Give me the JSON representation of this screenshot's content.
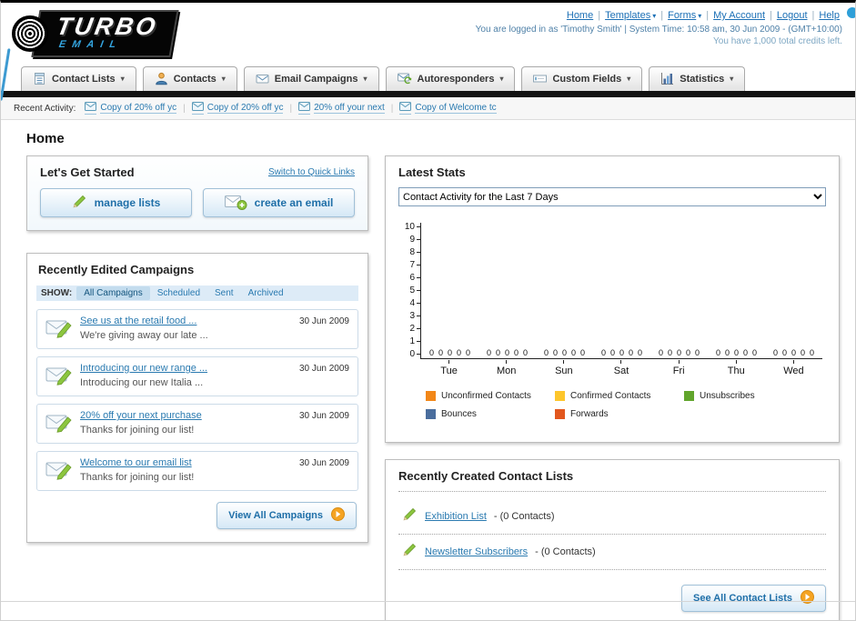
{
  "header": {
    "logo_text": "TURBO",
    "logo_sub": "EMAIL",
    "top_links": [
      {
        "label": "Home",
        "caret": false
      },
      {
        "label": "Templates",
        "caret": true
      },
      {
        "label": "Forms",
        "caret": true
      },
      {
        "label": "My Account",
        "caret": false
      },
      {
        "label": "Logout",
        "caret": false
      },
      {
        "label": "Help",
        "caret": false
      }
    ],
    "login_info": "You are logged in as 'Timothy Smith' | System Time: 10:58 am, 30 Jun 2009 - (GMT+10:00)",
    "credits": "You have 1,000 total credits left."
  },
  "nav": {
    "items": [
      {
        "label": "Contact Lists",
        "icon": "contact-lists-icon"
      },
      {
        "label": "Contacts",
        "icon": "contacts-icon"
      },
      {
        "label": "Email Campaigns",
        "icon": "email-campaigns-icon"
      },
      {
        "label": "Autoresponders",
        "icon": "autoresponders-icon"
      },
      {
        "label": "Custom Fields",
        "icon": "custom-fields-icon"
      },
      {
        "label": "Statistics",
        "icon": "statistics-icon"
      }
    ]
  },
  "recent_activity": {
    "label": "Recent Activity:",
    "items": [
      "Copy of 20% off yc",
      "Copy of 20% off yc",
      "20% off your next",
      "Copy of Welcome tc"
    ]
  },
  "page_title": "Home",
  "get_started": {
    "title": "Let's Get Started",
    "switch_link": "Switch to Quick Links",
    "buttons": [
      {
        "label": "manage lists"
      },
      {
        "label": "create an email"
      }
    ]
  },
  "campaigns": {
    "title": "Recently Edited Campaigns",
    "show_label": "SHOW:",
    "filters": [
      "All Campaigns",
      "Scheduled",
      "Sent",
      "Archived"
    ],
    "active_filter": "All Campaigns",
    "rows": [
      {
        "title": "See us at the retail food ...",
        "subtitle": "We're giving away our late ...",
        "date": "30 Jun 2009"
      },
      {
        "title": "Introducing our new range ...",
        "subtitle": "Introducing our new Italia ...",
        "date": "30 Jun 2009"
      },
      {
        "title": "20% off your next purchase",
        "subtitle": "Thanks for joining our list!",
        "date": "30 Jun 2009"
      },
      {
        "title": "Welcome to our email list",
        "subtitle": "Thanks for joining our list!",
        "date": "30 Jun 2009"
      }
    ],
    "view_all_label": "View All Campaigns"
  },
  "stats": {
    "title": "Latest Stats",
    "dropdown_value": "Contact Activity for the Last 7 Days",
    "legend": [
      {
        "label": "Unconfirmed Contacts",
        "color": "#f28718"
      },
      {
        "label": "Confirmed Contacts",
        "color": "#fdc62c"
      },
      {
        "label": "Unsubscribes",
        "color": "#61a52c"
      },
      {
        "label": "Bounces",
        "color": "#4a6d9d"
      },
      {
        "label": "Forwards",
        "color": "#e2571e"
      }
    ]
  },
  "chart_data": {
    "type": "bar",
    "title": "Contact Activity for the Last 7 Days",
    "categories": [
      "Tue",
      "Mon",
      "Sun",
      "Sat",
      "Fri",
      "Thu",
      "Wed"
    ],
    "series": [
      {
        "name": "Unconfirmed Contacts",
        "color": "#f28718",
        "values": [
          0,
          0,
          0,
          0,
          0,
          0,
          0
        ]
      },
      {
        "name": "Confirmed Contacts",
        "color": "#fdc62c",
        "values": [
          0,
          0,
          0,
          0,
          0,
          0,
          0
        ]
      },
      {
        "name": "Unsubscribes",
        "color": "#61a52c",
        "values": [
          0,
          0,
          0,
          0,
          0,
          0,
          0
        ]
      },
      {
        "name": "Bounces",
        "color": "#4a6d9d",
        "values": [
          0,
          0,
          0,
          0,
          0,
          0,
          0
        ]
      },
      {
        "name": "Forwards",
        "color": "#e2571e",
        "values": [
          0,
          0,
          0,
          0,
          0,
          0,
          0
        ]
      }
    ],
    "ylim": [
      0,
      10
    ],
    "yticks": [
      0,
      1,
      2,
      3,
      4,
      5,
      6,
      7,
      8,
      9,
      10
    ],
    "grid": false,
    "legend_position": "bottom"
  },
  "contact_lists": {
    "title": "Recently Created Contact Lists",
    "items": [
      {
        "name": "Exhibition List",
        "detail": "- (0 Contacts)"
      },
      {
        "name": "Newsletter Subscribers",
        "detail": "- (0 Contacts)"
      }
    ],
    "see_all_label": "See All Contact Lists"
  }
}
